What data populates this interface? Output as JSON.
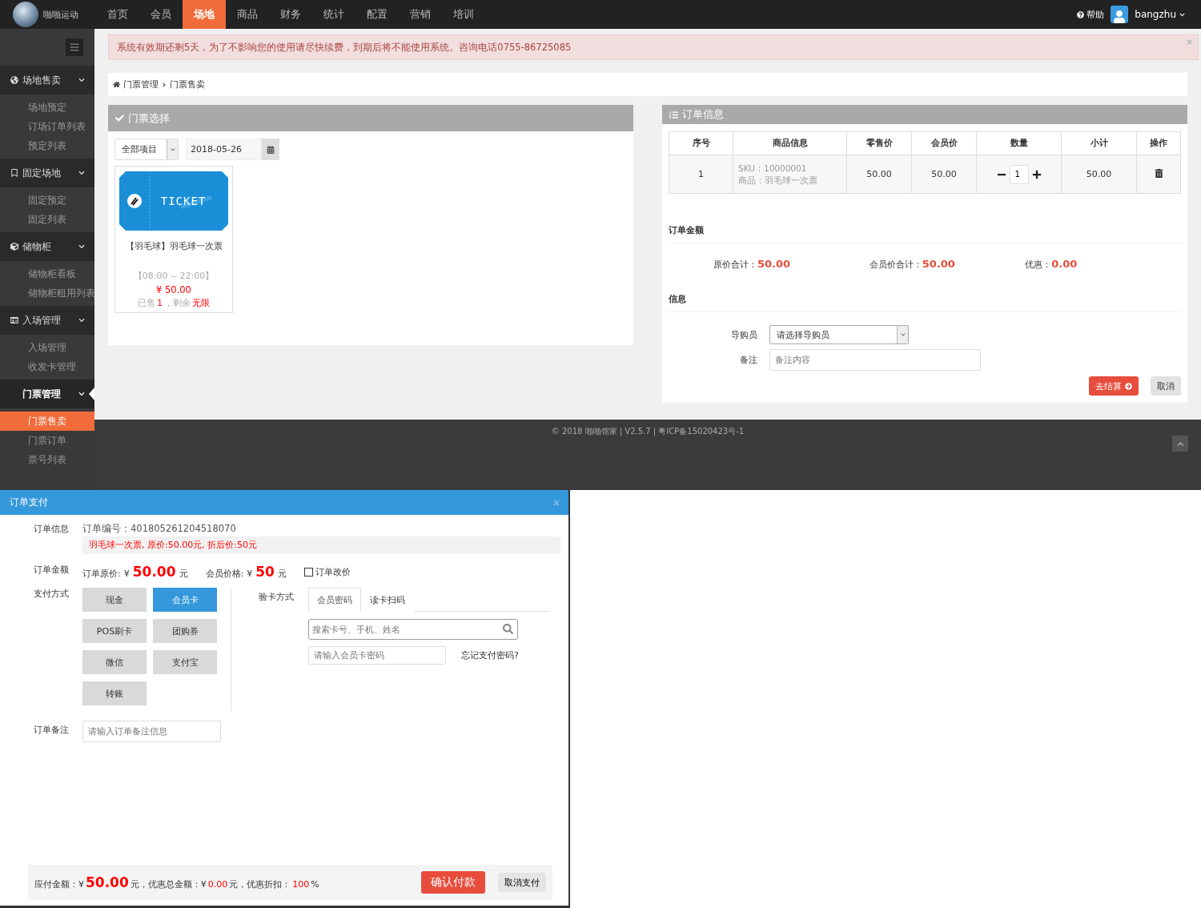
{
  "navbar": {
    "brand": "啪啪运动",
    "items": [
      {
        "label": "首页",
        "selected": false
      },
      {
        "label": "会员",
        "selected": false
      },
      {
        "label": "场地",
        "selected": true
      },
      {
        "label": "商品",
        "selected": false
      },
      {
        "label": "财务",
        "selected": false
      },
      {
        "label": "统计",
        "selected": false
      },
      {
        "label": "配置",
        "selected": false
      },
      {
        "label": "营销",
        "selected": false
      },
      {
        "label": "培训",
        "selected": false
      }
    ],
    "help": "帮助",
    "user": "bangzhu"
  },
  "sidebar": {
    "groups": [
      {
        "label": "场地售卖",
        "expanded": true,
        "selected": false,
        "items": [
          {
            "label": "场地预定",
            "selected": false
          },
          {
            "label": "订场订单列表",
            "selected": false
          },
          {
            "label": "预定列表",
            "selected": false
          }
        ]
      },
      {
        "label": "固定场地",
        "expanded": true,
        "selected": false,
        "items": [
          {
            "label": "固定预定",
            "selected": false
          },
          {
            "label": "固定列表",
            "selected": false
          }
        ]
      },
      {
        "label": "储物柜",
        "expanded": true,
        "selected": false,
        "items": [
          {
            "label": "储物柜看板",
            "selected": false
          },
          {
            "label": "储物柜租用列表",
            "selected": false
          }
        ]
      },
      {
        "label": "入场管理",
        "expanded": true,
        "selected": false,
        "items": [
          {
            "label": "入场管理",
            "selected": false
          },
          {
            "label": "收发卡管理",
            "selected": false
          }
        ]
      },
      {
        "label": "门票管理",
        "expanded": true,
        "selected": true,
        "items": [
          {
            "label": "门票售卖",
            "selected": true
          },
          {
            "label": "门票订单",
            "selected": false
          },
          {
            "label": "票号列表",
            "selected": false
          }
        ]
      }
    ]
  },
  "alert": {
    "text": "系统有效期还剩5天，为了不影响您的使用请尽快续费，到期后将不能使用系统。咨询电话0755-86725085"
  },
  "breadcrumb": [
    "门票管理",
    "门票售卖"
  ],
  "ticket_panel": {
    "title": "门票选择",
    "category_select": "全部项目",
    "date": "2018-05-26",
    "tickets": [
      {
        "image_text": "TICKET",
        "name": "【羽毛球】羽毛球一次票",
        "hours": "【08:00 -- 22:00】",
        "price": "¥ 50.00",
        "sold_label": "已售",
        "sold": "1",
        "remaining_label": "，剩余",
        "remaining": "无限"
      }
    ]
  },
  "order_panel": {
    "title": "订单信息",
    "columns": [
      "序号",
      "商品信息",
      "零售价",
      "会员价",
      "数量",
      "小计",
      "操作"
    ],
    "rows": [
      {
        "index": "1",
        "sku": "SKU：10000001",
        "product": "商品：羽毛球一次票",
        "retail_price": "50.00",
        "member_price": "50.00",
        "quantity": "1",
        "subtotal": "50.00"
      }
    ],
    "amount_heading": "订单金额",
    "totals": [
      {
        "label": "原价合计：",
        "value": "50.00"
      },
      {
        "label": "会员价合计：",
        "value": "50.00"
      },
      {
        "label": "优惠：",
        "value": "0.00"
      }
    ],
    "info_heading": "信息",
    "guide_label": "导购员",
    "guide_select": "请选择导购员",
    "note_label": "备注",
    "note_placeholder": "备注内容",
    "checkout": "去结算",
    "cancel": "取消"
  },
  "footer": {
    "text": "© 2018 啪啪馆家 | V2.5.7 | 粤ICP备15020423号-1"
  },
  "payment_dialog": {
    "title": "订单支付",
    "order_info_label": "订单信息",
    "order_number": "订单编号：401805261204518070",
    "order_summary": "羽毛球一次票, 原价:50.00元, 折后价:50元",
    "amount_label": "订单金额",
    "original": {
      "label": "订单原价:",
      "currency": "¥",
      "value": "50.00",
      "unit": "元"
    },
    "member": {
      "label": "会员价格:",
      "currency": "¥",
      "value": "50",
      "unit": "元"
    },
    "price_change": {
      "label": "订单改价",
      "checked": false
    },
    "method_label": "支付方式",
    "methods": [
      {
        "label": "现金",
        "selected": false
      },
      {
        "label": "会员卡",
        "selected": true
      },
      {
        "label": "POS刷卡",
        "selected": false
      },
      {
        "label": "团购券",
        "selected": false
      },
      {
        "label": "微信",
        "selected": false
      },
      {
        "label": "支付宝",
        "selected": false
      },
      {
        "label": "转账",
        "selected": false
      }
    ],
    "verify_label": "验卡方式",
    "verify_tabs": [
      {
        "label": "会员密码",
        "selected": true
      },
      {
        "label": "读卡扫码",
        "selected": false
      }
    ],
    "card_search_placeholder": "搜索卡号、手机、姓名",
    "password_placeholder": "请输入会员卡密码",
    "forgot": "忘记支付密码?",
    "remark_label": "订单备注",
    "remark_placeholder": "请输入订单备注信息",
    "summary": [
      {
        "kind": "plain",
        "text": "应付金额：¥"
      },
      {
        "kind": "large",
        "text": "50.00"
      },
      {
        "kind": "plain",
        "text": "元，优惠总金额：¥"
      },
      {
        "kind": "red",
        "text": "0.00"
      },
      {
        "kind": "plain",
        "text": "元，优惠折扣："
      },
      {
        "kind": "red",
        "text": "100"
      },
      {
        "kind": "plain",
        "text": "%"
      }
    ],
    "confirm": "确认付款",
    "cancel": "取消支付"
  }
}
